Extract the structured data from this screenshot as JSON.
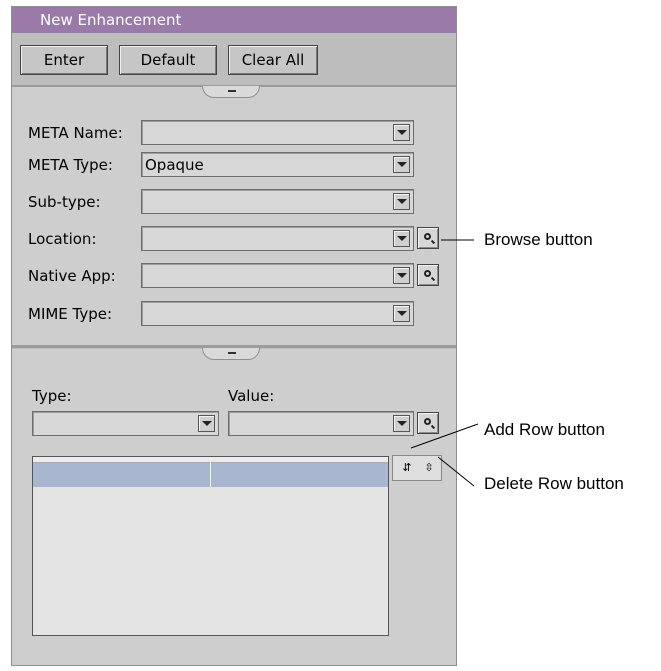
{
  "window": {
    "title": "New Enhancement",
    "title_color": "#9a7aa8"
  },
  "toolbar": {
    "enter": "Enter",
    "default": "Default",
    "clear_all": "Clear All"
  },
  "fields": {
    "meta_name": {
      "label": "META Name:",
      "value": ""
    },
    "meta_type": {
      "label": "META Type:",
      "value": "Opaque"
    },
    "sub_type": {
      "label": "Sub-type:",
      "value": ""
    },
    "location": {
      "label": "Location:",
      "value": ""
    },
    "native_app": {
      "label": "Native App:",
      "value": ""
    },
    "mime_type": {
      "label": "MIME Type:",
      "value": ""
    }
  },
  "lower": {
    "type_label": "Type:",
    "value_label": "Value:",
    "type_value": "",
    "value_value": "",
    "selection_color": "#a8b6d0"
  },
  "callouts": {
    "browse": "Browse button",
    "add_row": "Add Row button",
    "delete_row": "Delete Row button"
  },
  "icons": {
    "browse": "magnifier-icon",
    "add_row": "add-row-icon",
    "delete_row": "delete-row-icon"
  }
}
